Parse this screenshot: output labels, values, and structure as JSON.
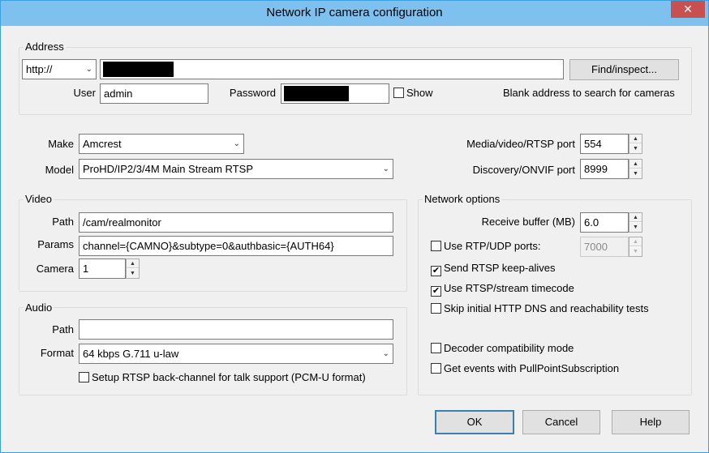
{
  "window": {
    "title": "Network IP camera configuration",
    "close_glyph": "✕"
  },
  "address": {
    "group_label": "Address",
    "protocol": "http://",
    "find_button": "Find/inspect...",
    "user_label": "User",
    "user_value": "admin",
    "password_label": "Password",
    "show_label": "Show",
    "hint": "Blank address to search for cameras"
  },
  "device": {
    "make_label": "Make",
    "make_value": "Amcrest",
    "model_label": "Model",
    "model_value": "ProHD/IP2/3/4M Main Stream RTSP",
    "media_port_label": "Media/video/RTSP port",
    "media_port_value": "554",
    "discovery_port_label": "Discovery/ONVIF port",
    "discovery_port_value": "8999"
  },
  "video": {
    "group_label": "Video",
    "path_label": "Path",
    "path_value": "/cam/realmonitor",
    "params_label": "Params",
    "params_value": "channel={CAMNO}&subtype=0&authbasic={AUTH64}",
    "camera_label": "Camera",
    "camera_value": "1"
  },
  "audio": {
    "group_label": "Audio",
    "path_label": "Path",
    "path_value": "",
    "format_label": "Format",
    "format_value": "64 kbps G.711 u-law",
    "backchannel_label": "Setup RTSP back-channel for talk support (PCM-U format)",
    "backchannel_checked": false
  },
  "network": {
    "group_label": "Network options",
    "buffer_label": "Receive buffer (MB)",
    "buffer_value": "6.0",
    "udp_label": "Use RTP/UDP ports:",
    "udp_value": "7000",
    "keepalive_label": "Send RTSP keep-alives",
    "timecode_label": "Use RTSP/stream timecode",
    "skip_label": "Skip initial HTTP DNS and reachability tests",
    "decoder_label": "Decoder compatibility mode",
    "events_label": "Get events with PullPointSubscription"
  },
  "buttons": {
    "ok": "OK",
    "cancel": "Cancel",
    "help": "Help"
  },
  "icons": {
    "check": "✔",
    "dropdown": "⌄",
    "spin_up": "▲",
    "spin_down": "▼"
  }
}
